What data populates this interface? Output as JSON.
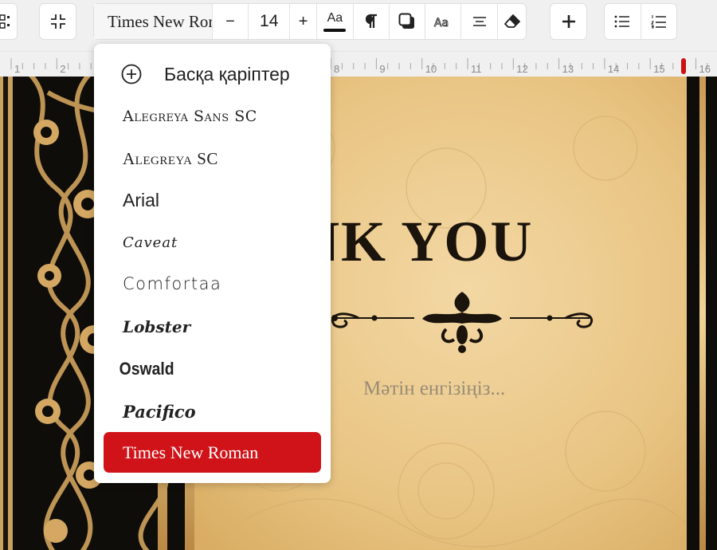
{
  "toolbar": {
    "font_value": "Times New Roman",
    "font_size": "14",
    "minus": "−",
    "plus": "+",
    "text_case": "Aa",
    "colors": {
      "accent": "#d01318",
      "toolbar_bg": "#f0f0f1"
    }
  },
  "ruler": {
    "ticks": [
      "1",
      "2",
      "8",
      "9",
      "10",
      "11",
      "12",
      "13",
      "14",
      "15",
      "16"
    ]
  },
  "font_dropdown": {
    "more_fonts_label": "Басқа қаріптер",
    "fonts": [
      "Alegreya Sans SC",
      "Alegreya SC",
      "Arial",
      "Caveat",
      "Comfortaa",
      "Lobster",
      "Oswald",
      "Pacifico"
    ],
    "selected": "Times New Roman"
  },
  "card": {
    "title": "HANK YOU",
    "text_placeholder": "Мәтін енгізіңіз..."
  }
}
